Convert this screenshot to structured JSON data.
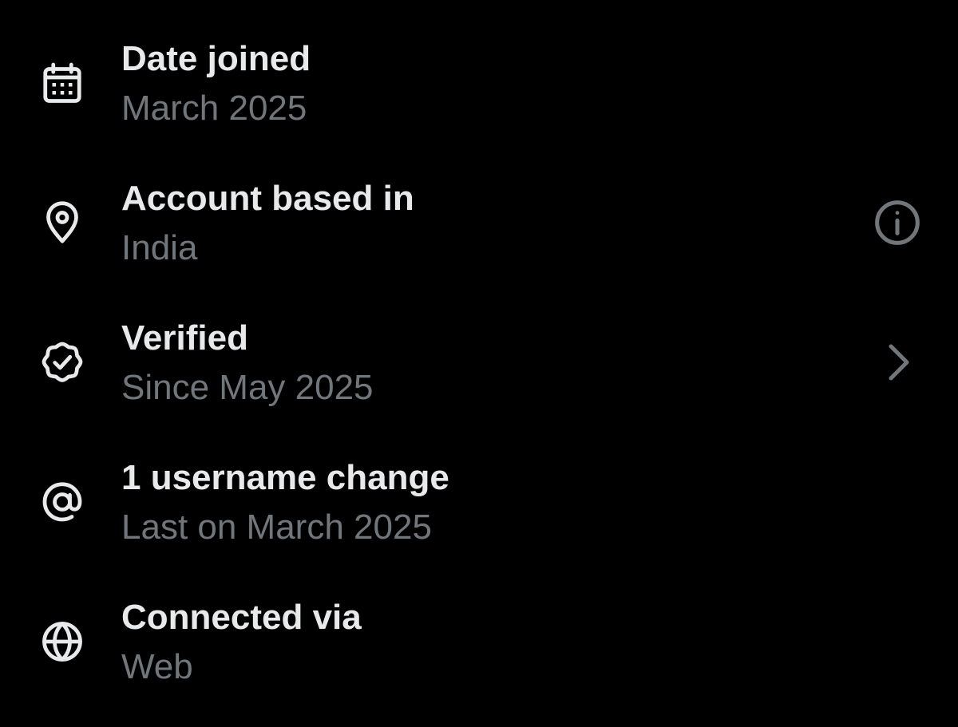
{
  "colors": {
    "background": "#000000",
    "primary_text": "#e7e9ea",
    "secondary_text": "#71767b"
  },
  "items": [
    {
      "icon": "calendar-icon",
      "title": "Date joined",
      "subtitle": "March 2025"
    },
    {
      "icon": "location-pin-icon",
      "title": "Account based in",
      "subtitle": "India",
      "trailing_icon": "info-icon"
    },
    {
      "icon": "verified-badge-icon",
      "title": "Verified",
      "subtitle": "Since May 2025",
      "trailing_icon": "chevron-right-icon"
    },
    {
      "icon": "at-sign-icon",
      "title": "1 username change",
      "subtitle": "Last on March 2025"
    },
    {
      "icon": "globe-icon",
      "title": "Connected via",
      "subtitle": "Web"
    }
  ]
}
